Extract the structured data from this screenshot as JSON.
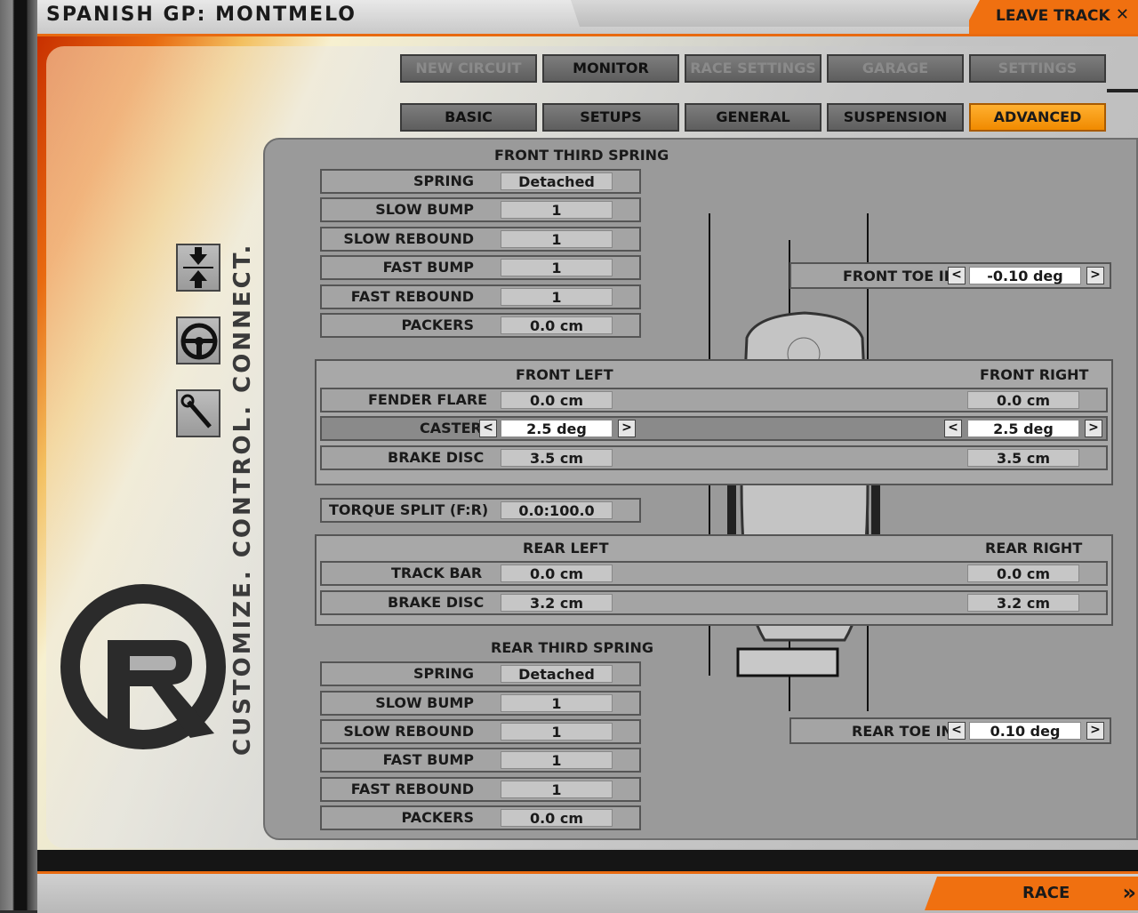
{
  "window": {
    "title": "SPANISH GP: MONTMELO",
    "leave_track": "LEAVE TRACK",
    "close_glyph": "✕"
  },
  "top_tabs": [
    {
      "label": "NEW CIRCUIT",
      "state": "disabled"
    },
    {
      "label": "MONITOR",
      "state": "normal"
    },
    {
      "label": "RACE SETTINGS",
      "state": "disabled"
    },
    {
      "label": "GARAGE",
      "state": "disabled"
    },
    {
      "label": "SETTINGS",
      "state": "disabled"
    }
  ],
  "sub_tabs": [
    {
      "label": "BASIC",
      "state": "normal"
    },
    {
      "label": "SETUPS",
      "state": "normal"
    },
    {
      "label": "GENERAL",
      "state": "normal"
    },
    {
      "label": "SUSPENSION",
      "state": "normal"
    },
    {
      "label": "ADVANCED",
      "state": "active"
    }
  ],
  "side": {
    "tagline": "CUSTOMIZE. CONTROL. CONNECT.",
    "icons": [
      "compress-arrows-icon",
      "steering-wheel-icon",
      "wrench-icon"
    ]
  },
  "front_third_spring": {
    "title": "FRONT THIRD SPRING",
    "rows": [
      {
        "label": "SPRING",
        "value": "Detached"
      },
      {
        "label": "SLOW BUMP",
        "value": "1"
      },
      {
        "label": "SLOW REBOUND",
        "value": "1"
      },
      {
        "label": "FAST BUMP",
        "value": "1"
      },
      {
        "label": "FAST REBOUND",
        "value": "1"
      },
      {
        "label": "PACKERS",
        "value": "0.0 cm"
      }
    ]
  },
  "front_group": {
    "left_title": "FRONT LEFT",
    "right_title": "FRONT RIGHT",
    "fender_flare_label": "FENDER FLARE",
    "fender_flare_left": "0.0 cm",
    "fender_flare_right": "0.0 cm",
    "caster_label": "CASTER",
    "caster_left": "2.5 deg",
    "caster_right": "2.5 deg",
    "brake_disc_label": "BRAKE DISC",
    "brake_disc_left": "3.5 cm",
    "brake_disc_right": "3.5 cm"
  },
  "torque_split": {
    "label": "TORQUE SPLIT (F:R)",
    "value": "0.0:100.0"
  },
  "rear_group": {
    "left_title": "REAR LEFT",
    "right_title": "REAR RIGHT",
    "track_bar_label": "TRACK BAR",
    "track_bar_left": "0.0 cm",
    "track_bar_right": "0.0 cm",
    "brake_disc_label": "BRAKE DISC",
    "brake_disc_left": "3.2 cm",
    "brake_disc_right": "3.2 cm"
  },
  "rear_third_spring": {
    "title": "REAR THIRD SPRING",
    "rows": [
      {
        "label": "SPRING",
        "value": "Detached"
      },
      {
        "label": "SLOW BUMP",
        "value": "1"
      },
      {
        "label": "SLOW REBOUND",
        "value": "1"
      },
      {
        "label": "FAST BUMP",
        "value": "1"
      },
      {
        "label": "FAST REBOUND",
        "value": "1"
      },
      {
        "label": "PACKERS",
        "value": "0.0 cm"
      }
    ]
  },
  "toe": {
    "front_label": "FRONT TOE IN",
    "front_value": "-0.10 deg",
    "rear_label": "REAR TOE IN",
    "rear_value": "0.10 deg"
  },
  "bottom": {
    "race_label": "RACE",
    "race_glyph": "»"
  },
  "arrows": {
    "left": "<",
    "right": ">"
  },
  "colors": {
    "accent_orange": "#f07010",
    "active_tab": "#ffa020"
  }
}
